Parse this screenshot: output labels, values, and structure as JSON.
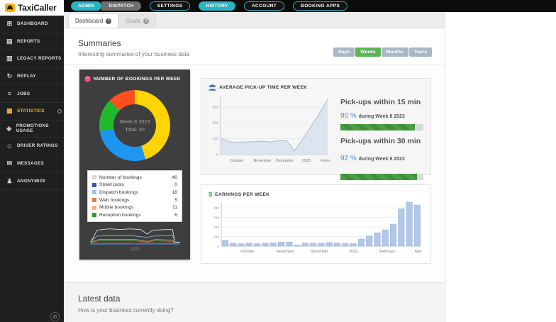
{
  "topbar": {
    "logo_text": "TaxiCaller",
    "nav_groups": [
      {
        "items": [
          {
            "label": "ADMIN",
            "variant": "solid-teal"
          },
          {
            "label": "DISPATCH",
            "variant": "solid-gray"
          }
        ]
      },
      {
        "items": [
          {
            "label": "SETTINGS",
            "variant": "outline"
          }
        ]
      },
      {
        "items": [
          {
            "label": "HISTORY",
            "variant": "solid-teal"
          }
        ]
      },
      {
        "items": [
          {
            "label": "ACCOUNT",
            "variant": "outline"
          }
        ]
      },
      {
        "items": [
          {
            "label": "BOOKING APPS",
            "variant": "outline"
          }
        ]
      }
    ],
    "accent_color": "#2ab4c3"
  },
  "tabs": [
    {
      "label": "Dashboard",
      "badge": "?",
      "active": true
    },
    {
      "label": "Goals",
      "badge": "?",
      "active": false
    }
  ],
  "sidebar": {
    "items": [
      {
        "label": "DASHBOARD",
        "icon": "grid-icon",
        "glyph": "⊞",
        "active": false,
        "badge": false
      },
      {
        "label": "REPORTS",
        "icon": "report-icon",
        "glyph": "▤",
        "active": false,
        "badge": false
      },
      {
        "label": "LEGACY REPORTS",
        "icon": "printer-icon",
        "glyph": "▥",
        "active": false,
        "badge": false
      },
      {
        "label": "REPLAY",
        "icon": "replay-icon",
        "glyph": "↻",
        "active": false,
        "badge": false
      },
      {
        "label": "JOBS",
        "icon": "layers-icon",
        "glyph": "≡",
        "active": false,
        "badge": false
      },
      {
        "label": "STATISTICS",
        "icon": "chart-icon",
        "glyph": "▦",
        "active": true,
        "badge": true
      },
      {
        "label": "PROMOTIONS USAGE",
        "icon": "tag-icon",
        "glyph": "◈",
        "active": false,
        "badge": false
      },
      {
        "label": "DRIVER RATINGS",
        "icon": "smiley-icon",
        "glyph": "☺",
        "active": false,
        "badge": false
      },
      {
        "label": "MESSAGES",
        "icon": "envelope-icon",
        "glyph": "✉",
        "active": false,
        "badge": false
      },
      {
        "label": "ANONYMIZE",
        "icon": "person-icon",
        "glyph": "♟",
        "active": false,
        "badge": false
      }
    ],
    "active_color": "#f0b32b"
  },
  "summaries": {
    "title": "Summaries",
    "subtitle": "Interesting summaries of your business data",
    "period_buttons": [
      "Days",
      "Weeks",
      "Months",
      "Years"
    ],
    "active_period": "Weeks",
    "active_period_color": "#5cb457"
  },
  "bookings_panel": {
    "title": "NUMBER OF BOOKINGS PER WEEK",
    "icon": "cube-icon",
    "center_line1": "Week 8 2023",
    "center_line2": "Total: 40",
    "legend": [
      {
        "label": "Number of bookings",
        "value": "40",
        "color": "#d9d9d9"
      },
      {
        "label": "Street picks",
        "value": "0",
        "color": "#2e5aa8"
      },
      {
        "label": "Dispatch bookings",
        "value": "18",
        "color": "#9fc5e8"
      },
      {
        "label": "Web bookings",
        "value": "5",
        "color": "#ed7d31"
      },
      {
        "label": "Mobile bookings",
        "value": "11",
        "color": "#f4b183"
      },
      {
        "label": "Reception bookings",
        "value": "6",
        "color": "#2d9a35"
      }
    ],
    "spark_label": "2023"
  },
  "pickup_panel": {
    "title": "AVERAGE PICK-UP TIME PER WEEK",
    "icon": "people-icon",
    "stats": [
      {
        "title": "Pick-ups within 15 min",
        "pct": "90 %",
        "during": "during Week 8 2023",
        "bar_pct": 90
      },
      {
        "title": "Pick-ups within 30 min",
        "pct": "92 %",
        "during": "during Week 8 2023",
        "bar_pct": 92
      }
    ]
  },
  "earnings_panel": {
    "title": "EARNINGS PER WEEK",
    "icon": "dollar-icon",
    "dollar_glyph": "$"
  },
  "latest": {
    "title": "Latest data",
    "subtitle": "How is your business currently doing?"
  },
  "chart_data": [
    {
      "id": "bookings_donut",
      "type": "pie",
      "title": "Number of bookings per week",
      "center": [
        "Week 8 2023",
        "Total: 40"
      ],
      "total": 40,
      "segments": [
        {
          "label": "Dispatch bookings",
          "value": 18,
          "color": "#ffd400"
        },
        {
          "label": "Mobile bookings",
          "value": 11,
          "color": "#1e96f0"
        },
        {
          "label": "Reception bookings",
          "value": 6,
          "color": "#23b92d"
        },
        {
          "label": "Web bookings",
          "value": 5,
          "color": "#ff4f1f"
        }
      ]
    },
    {
      "id": "pickup_line",
      "type": "area",
      "title": "Average pick-up time per week",
      "ylim": [
        0,
        350
      ],
      "yticks": [
        0,
        100,
        200,
        300
      ],
      "values": [
        105,
        82,
        78,
        80,
        82,
        85,
        80,
        88,
        90,
        25,
        100,
        180,
        260,
        350
      ],
      "xticks": [
        {
          "label": "October",
          "pos": 0.15
        },
        {
          "label": "November",
          "pos": 0.39
        },
        {
          "label": "December",
          "pos": 0.6
        },
        {
          "label": "2023",
          "pos": 0.8
        },
        {
          "label": "Febru",
          "pos": 0.98
        }
      ],
      "line_color": "#aebfd6",
      "fill_color": "#d7e1ee"
    },
    {
      "id": "earnings_bar",
      "type": "bar",
      "title": "Earnings per week",
      "ylim": [
        0,
        460
      ],
      "yticks": [
        0,
        100,
        200,
        300,
        400
      ],
      "values": [
        60,
        30,
        25,
        30,
        25,
        30,
        35,
        42,
        42,
        12,
        32,
        30,
        32,
        38,
        32,
        26,
        26,
        75,
        105,
        140,
        170,
        230,
        390,
        460,
        430
      ],
      "xticks": [
        {
          "label": "October",
          "pos": 0.13
        },
        {
          "label": "November",
          "pos": 0.32
        },
        {
          "label": "December",
          "pos": 0.49
        },
        {
          "label": "2023",
          "pos": 0.66
        },
        {
          "label": "February",
          "pos": 0.83
        },
        {
          "label": "Mar",
          "pos": 0.985
        }
      ],
      "bar_color": "#b3c7e6",
      "bar_border": "#93afd7"
    },
    {
      "id": "bookings_sparkline",
      "type": "line",
      "title": "Bookings trend 2023",
      "series": [
        {
          "name": "total",
          "color": "#d2d2d2",
          "points": [
            [
              2,
              26
            ],
            [
              12,
              7
            ],
            [
              30,
              5
            ],
            [
              48,
              6
            ],
            [
              62,
              5
            ],
            [
              78,
              6
            ],
            [
              88,
              13
            ],
            [
              96,
              7
            ],
            [
              118,
              6
            ],
            [
              126,
              6
            ],
            [
              130,
              26
            ],
            [
              137,
              26
            ]
          ]
        },
        {
          "name": "dispatch",
          "color": "#8ab0d9",
          "points": [
            [
              2,
              24
            ],
            [
              12,
              16
            ],
            [
              40,
              15
            ],
            [
              62,
              15
            ],
            [
              88,
              18
            ],
            [
              96,
              16
            ],
            [
              126,
              15
            ],
            [
              130,
              25
            ],
            [
              137,
              25
            ]
          ]
        },
        {
          "name": "mobile",
          "color": "#d99a3d",
          "points": [
            [
              2,
              25
            ],
            [
              15,
              21
            ],
            [
              45,
              21
            ],
            [
              70,
              21
            ],
            [
              88,
              24
            ],
            [
              100,
              21
            ],
            [
              126,
              22
            ],
            [
              130,
              26
            ]
          ]
        },
        {
          "name": "reception",
          "color": "#4aa54a",
          "points": [
            [
              2,
              26
            ],
            [
              15,
              23
            ],
            [
              45,
              23
            ],
            [
              70,
              23
            ],
            [
              88,
              25
            ],
            [
              100,
              23
            ],
            [
              126,
              24
            ],
            [
              130,
              27
            ]
          ]
        },
        {
          "name": "web",
          "color": "#d05050",
          "points": [
            [
              2,
              27
            ],
            [
              60,
              26.5
            ],
            [
              130,
              27
            ]
          ]
        },
        {
          "name": "street",
          "color": "#4f7fd0",
          "points": [
            [
              2,
              28
            ],
            [
              137,
              28
            ]
          ]
        }
      ]
    }
  ]
}
